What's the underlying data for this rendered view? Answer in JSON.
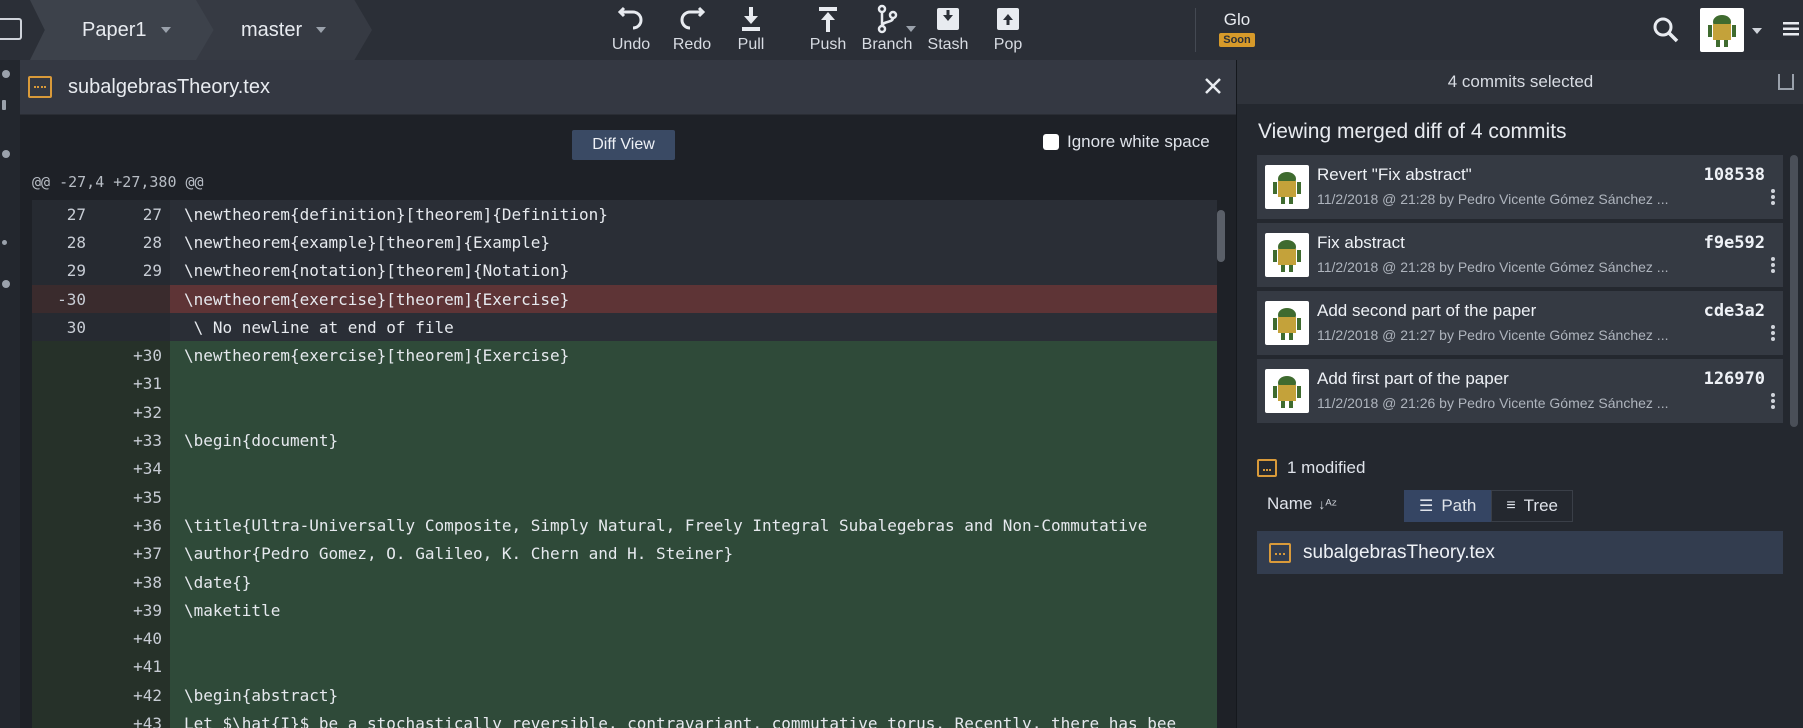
{
  "toolbar": {
    "repo": "Paper1",
    "branch": "master",
    "tools": [
      {
        "label": "Undo",
        "icon": "undo-icon"
      },
      {
        "label": "Redo",
        "icon": "redo-icon"
      },
      {
        "label": "Pull",
        "icon": "pull-icon"
      },
      {
        "label": "Push",
        "icon": "push-icon"
      },
      {
        "label": "Branch",
        "icon": "branch-icon"
      },
      {
        "label": "Stash",
        "icon": "stash-icon"
      },
      {
        "label": "Pop",
        "icon": "pop-icon"
      }
    ],
    "glo": "Glo",
    "glo_badge": "Soon"
  },
  "diff": {
    "filename": "subalgebrasTheory.tex",
    "view_button": "Diff View",
    "ignore_whitespace": "Ignore white space",
    "hunk": "@@ -27,4 +27,380 @@",
    "rows": [
      {
        "old": "27",
        "new": "27",
        "text": "\\newtheorem{definition}[theorem]{Definition}",
        "type": "ctx"
      },
      {
        "old": "28",
        "new": "28",
        "text": "\\newtheorem{example}[theorem]{Example}",
        "type": "ctx"
      },
      {
        "old": "29",
        "new": "29",
        "text": "\\newtheorem{notation}[theorem]{Notation}",
        "type": "ctx"
      },
      {
        "old": "-30",
        "new": "",
        "text": "\\newtheorem{exercise}[theorem]{Exercise}",
        "type": "del"
      },
      {
        "old": "30",
        "new": "",
        "text": " \\ No newline at end of file",
        "type": "ctx"
      },
      {
        "old": "",
        "new": "+30",
        "text": "\\newtheorem{exercise}[theorem]{Exercise}",
        "type": "add"
      },
      {
        "old": "",
        "new": "+31",
        "text": "",
        "type": "add"
      },
      {
        "old": "",
        "new": "+32",
        "text": "",
        "type": "add"
      },
      {
        "old": "",
        "new": "+33",
        "text": "\\begin{document}",
        "type": "add"
      },
      {
        "old": "",
        "new": "+34",
        "text": "",
        "type": "add"
      },
      {
        "old": "",
        "new": "+35",
        "text": "",
        "type": "add"
      },
      {
        "old": "",
        "new": "+36",
        "text": "\\title{Ultra-Universally Composite, Simply Natural, Freely Integral Subalegebras and Non-Commutative",
        "type": "add"
      },
      {
        "old": "",
        "new": "+37",
        "text": "\\author{Pedro Gomez, O. Galileo, K. Chern and H. Steiner}",
        "type": "add"
      },
      {
        "old": "",
        "new": "+38",
        "text": "\\date{}",
        "type": "add"
      },
      {
        "old": "",
        "new": "+39",
        "text": "\\maketitle",
        "type": "add"
      },
      {
        "old": "",
        "new": "+40",
        "text": "",
        "type": "add"
      },
      {
        "old": "",
        "new": "+41",
        "text": "",
        "type": "add"
      },
      {
        "old": "",
        "new": "+42",
        "text": "\\begin{abstract}",
        "type": "add"
      },
      {
        "old": "",
        "new": "+43",
        "text": "Let $\\hat{I}$ be a stochastically reversible, contravariant, commutative torus. Recently, there has bee",
        "type": "add"
      }
    ]
  },
  "commits_panel": {
    "header": "4 commits selected",
    "title": "Viewing merged diff of 4 commits",
    "commits": [
      {
        "message": "Revert \"Fix abstract\"",
        "meta": "11/2/2018 @ 21:28 by Pedro Vicente Gómez Sánchez ...",
        "sha": "108538"
      },
      {
        "message": "Fix abstract",
        "meta": "11/2/2018 @ 21:28 by Pedro Vicente Gómez Sánchez ...",
        "sha": "f9e592"
      },
      {
        "message": "Add second part of the paper",
        "meta": "11/2/2018 @ 21:27 by Pedro Vicente Gómez Sánchez ...",
        "sha": "cde3a2"
      },
      {
        "message": "Add first part of the paper",
        "meta": "11/2/2018 @ 21:26 by Pedro Vicente Gómez Sánchez ...",
        "sha": "126970"
      }
    ],
    "modified": "1 modified",
    "sort_label": "Name",
    "view_path": "Path",
    "view_tree": "Tree",
    "files": [
      "subalgebrasTheory.tex"
    ]
  },
  "colors": {
    "accent": "#354563",
    "added": "#2f4a39",
    "removed": "#5e3436",
    "file_icon": "#d99a3a"
  }
}
